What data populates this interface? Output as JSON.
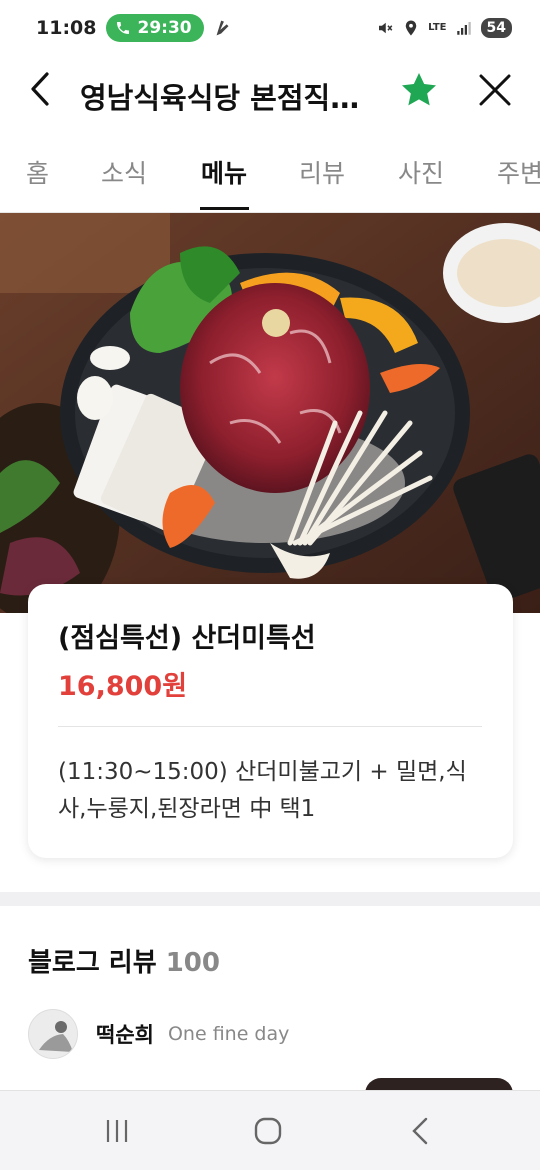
{
  "status_bar": {
    "time": "11:08",
    "call_timer": "29:30",
    "network": "LTE",
    "battery": "54",
    "accent_color": "#3cb55a"
  },
  "header": {
    "title": "영남식육식당 본점직영 산더미불고기",
    "back_icon": "chevron-left-icon",
    "star_icon": "star-icon",
    "star_color": "#1fa754",
    "close_icon": "close-icon"
  },
  "tabs": [
    {
      "label": "홈"
    },
    {
      "label": "소식"
    },
    {
      "label": "메뉴",
      "active": true
    },
    {
      "label": "리뷰"
    },
    {
      "label": "사진"
    },
    {
      "label": "주변"
    }
  ],
  "menu_item": {
    "name": "(점심특선) 산더미특선",
    "price": "16,800원",
    "price_color": "#e2403b",
    "description": "(11:30~15:00) 산더미불고기 + 밀면,식사,누룽지,된장라면 中 택1"
  },
  "blog_review": {
    "title": "블로그 리뷰",
    "count": "100",
    "reviewer_name": "떡순희",
    "reviewer_blog": "One fine day"
  },
  "nav_bar": {
    "recent_icon": "recent-apps-icon",
    "home_icon": "home-icon",
    "back_icon": "back-icon"
  }
}
